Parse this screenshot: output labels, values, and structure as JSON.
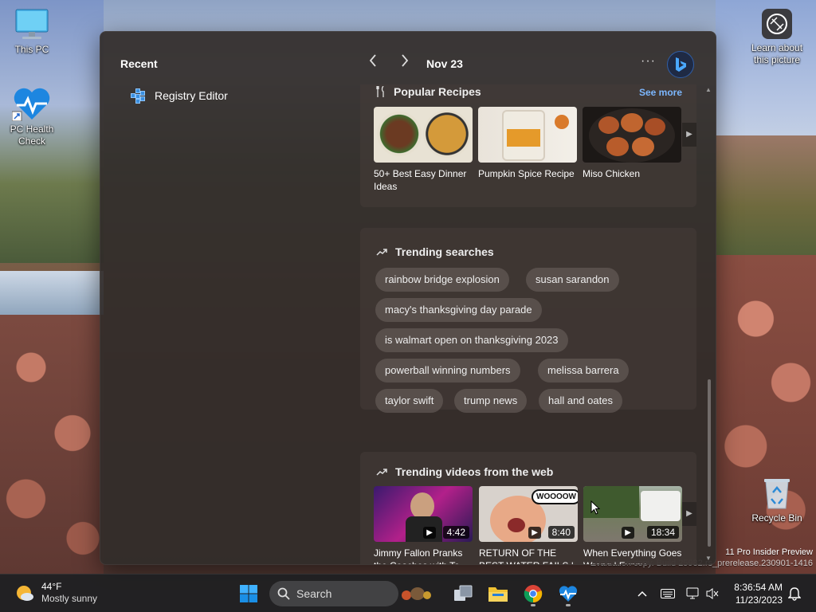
{
  "desktop": {
    "icons": [
      {
        "label": "This PC"
      },
      {
        "label": "PC Health Check"
      },
      {
        "label": "Learn about this picture"
      },
      {
        "label": "Recycle Bin"
      }
    ],
    "watermark": {
      "line1": "11 Pro Insider Preview",
      "line2": "Evaluation copy. Build 25982.rs_prerelease.230901-1416"
    }
  },
  "widgets": {
    "recent_title": "Recent",
    "recent_items": [
      {
        "label": "Registry Editor",
        "icon": "registry-icon"
      }
    ],
    "date": "Nov 23",
    "more_label": "···",
    "recipes": {
      "title": "Popular Recipes",
      "see_more": "See more",
      "items": [
        {
          "caption": "50+ Best Easy Dinner Ideas"
        },
        {
          "caption": "Pumpkin Spice Recipe"
        },
        {
          "caption": "Miso Chicken"
        }
      ]
    },
    "trending": {
      "title": "Trending searches",
      "chips": [
        "rainbow bridge explosion",
        "susan sarandon",
        "macy's thanksgiving day parade",
        "is walmart open on thanksgiving 2023",
        "powerball winning numbers",
        "melissa barrera",
        "taylor swift",
        "trump news",
        "hall and oates"
      ]
    },
    "videos": {
      "title": "Trending videos from the web",
      "items": [
        {
          "caption": "Jimmy Fallon Pranks the Coaches with To...",
          "duration": "4:42"
        },
        {
          "caption": "RETURN OF THE BEST WATER FAILS | What ...",
          "duration": "8:40",
          "badge": "WOOOOW"
        },
        {
          "caption": "When Everything Goes Wrong | Funny ...",
          "duration": "18:34"
        }
      ]
    }
  },
  "taskbar": {
    "weather_temp": "44°F",
    "weather_desc": "Mostly sunny",
    "search_label": "Search",
    "time": "8:36:54 AM",
    "date": "11/23/2023"
  },
  "colors": {
    "accent_link": "#7cb7ff",
    "panel_bg": "#322c2a",
    "taskbar_bg": "#202022"
  }
}
